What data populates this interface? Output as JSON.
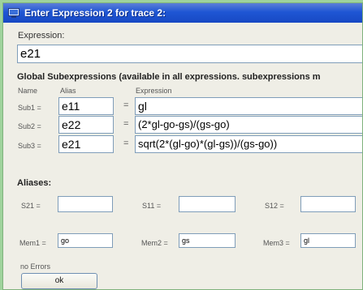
{
  "window": {
    "title": "Enter Expression 2 for trace 2:"
  },
  "expression": {
    "label": "Expression:",
    "value": "e21"
  },
  "global": {
    "heading": "Global Subexpressions (available in all expressions. subexpressions m",
    "col_name": "Name",
    "col_alias": "Alias",
    "col_expression": "Expression",
    "rows": [
      {
        "name": "Sub1 =",
        "alias": "e11",
        "eq": "=",
        "expr": "gl"
      },
      {
        "name": "Sub2 =",
        "alias": "e22",
        "eq": "=",
        "expr": "(2*gl-go-gs)/(gs-go)"
      },
      {
        "name": "Sub3 =",
        "alias": "e21",
        "eq": "=",
        "expr": "sqrt(2*(gl-go)*(gl-gs))/(gs-go))"
      }
    ]
  },
  "aliases": {
    "heading": "Aliases:",
    "s": [
      {
        "label": "S21 =",
        "value": ""
      },
      {
        "label": "S11 =",
        "value": ""
      },
      {
        "label": "S12 =",
        "value": ""
      }
    ],
    "mem": [
      {
        "label": "Mem1 =",
        "value": "go"
      },
      {
        "label": "Mem2 =",
        "value": "gs"
      },
      {
        "label": "Mem3 =",
        "value": "gl"
      }
    ]
  },
  "status": "no Errors",
  "ok_label": "ok"
}
